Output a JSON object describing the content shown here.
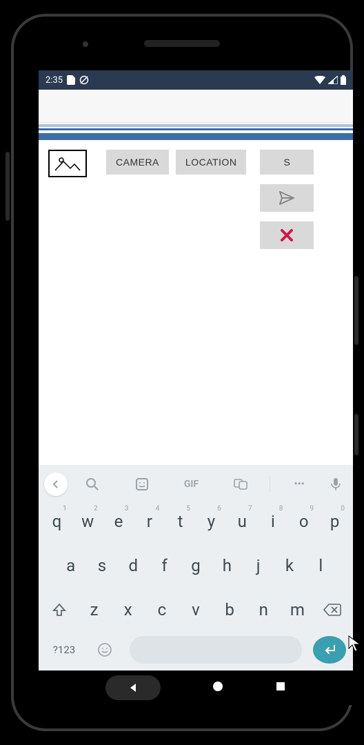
{
  "status_bar": {
    "time": "2:35"
  },
  "toolbar": {
    "camera_label": "CAMERA",
    "location_label": "LOCATION",
    "share_label": "S"
  },
  "ime": {
    "gif_label": "GIF",
    "more_label": "•••"
  },
  "keyboard": {
    "row1": [
      {
        "k": "q",
        "s": "1"
      },
      {
        "k": "w",
        "s": "2"
      },
      {
        "k": "e",
        "s": "3"
      },
      {
        "k": "r",
        "s": "4"
      },
      {
        "k": "t",
        "s": "5"
      },
      {
        "k": "y",
        "s": "6"
      },
      {
        "k": "u",
        "s": "7"
      },
      {
        "k": "i",
        "s": "8"
      },
      {
        "k": "o",
        "s": "9"
      },
      {
        "k": "p",
        "s": "0"
      }
    ],
    "row2": [
      {
        "k": "a"
      },
      {
        "k": "s"
      },
      {
        "k": "d"
      },
      {
        "k": "f"
      },
      {
        "k": "g"
      },
      {
        "k": "h"
      },
      {
        "k": "j"
      },
      {
        "k": "k"
      },
      {
        "k": "l"
      }
    ],
    "row3": [
      {
        "k": "z"
      },
      {
        "k": "x"
      },
      {
        "k": "c"
      },
      {
        "k": "v"
      },
      {
        "k": "b"
      },
      {
        "k": "n"
      },
      {
        "k": "m"
      }
    ],
    "symbols_label": "?123"
  }
}
